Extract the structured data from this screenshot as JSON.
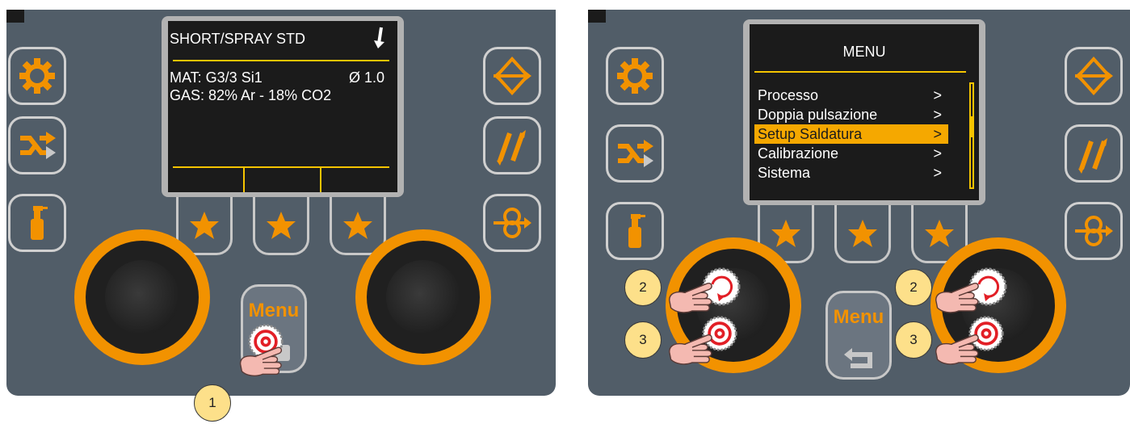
{
  "panel_left": {
    "screen": {
      "title": "SHORT/SPRAY STD",
      "material": "MAT: G3/3 Si1",
      "wire_diameter": "Ø 1.0",
      "gas": "GAS: 82% Ar - 18% CO2"
    },
    "menu_button_label": "Menu",
    "callout": "1"
  },
  "panel_right": {
    "screen": {
      "title": "MENU",
      "items": [
        {
          "label": "Processo",
          "arrow": ">"
        },
        {
          "label": "Doppia pulsazione",
          "arrow": ">"
        },
        {
          "label": "Setup Saldatura",
          "arrow": ">",
          "selected": true
        },
        {
          "label": "Calibrazione",
          "arrow": ">"
        },
        {
          "label": "Sistema",
          "arrow": ">"
        }
      ]
    },
    "menu_button_label": "Menu",
    "callouts": [
      "2",
      "3",
      "2",
      "3"
    ]
  },
  "colors": {
    "panel": "#515d68",
    "accent": "#f29200",
    "screen": "#1b1b1b",
    "selection": "#f5a800",
    "button_border": "#d0d0d0"
  },
  "icons": [
    "gear-icon",
    "shuffle-icon",
    "spray-bottle-icon",
    "diamond-arrow-icon",
    "double-arrow-icon",
    "wire-feed-icon",
    "star-icon",
    "hand-pointer-icon"
  ]
}
